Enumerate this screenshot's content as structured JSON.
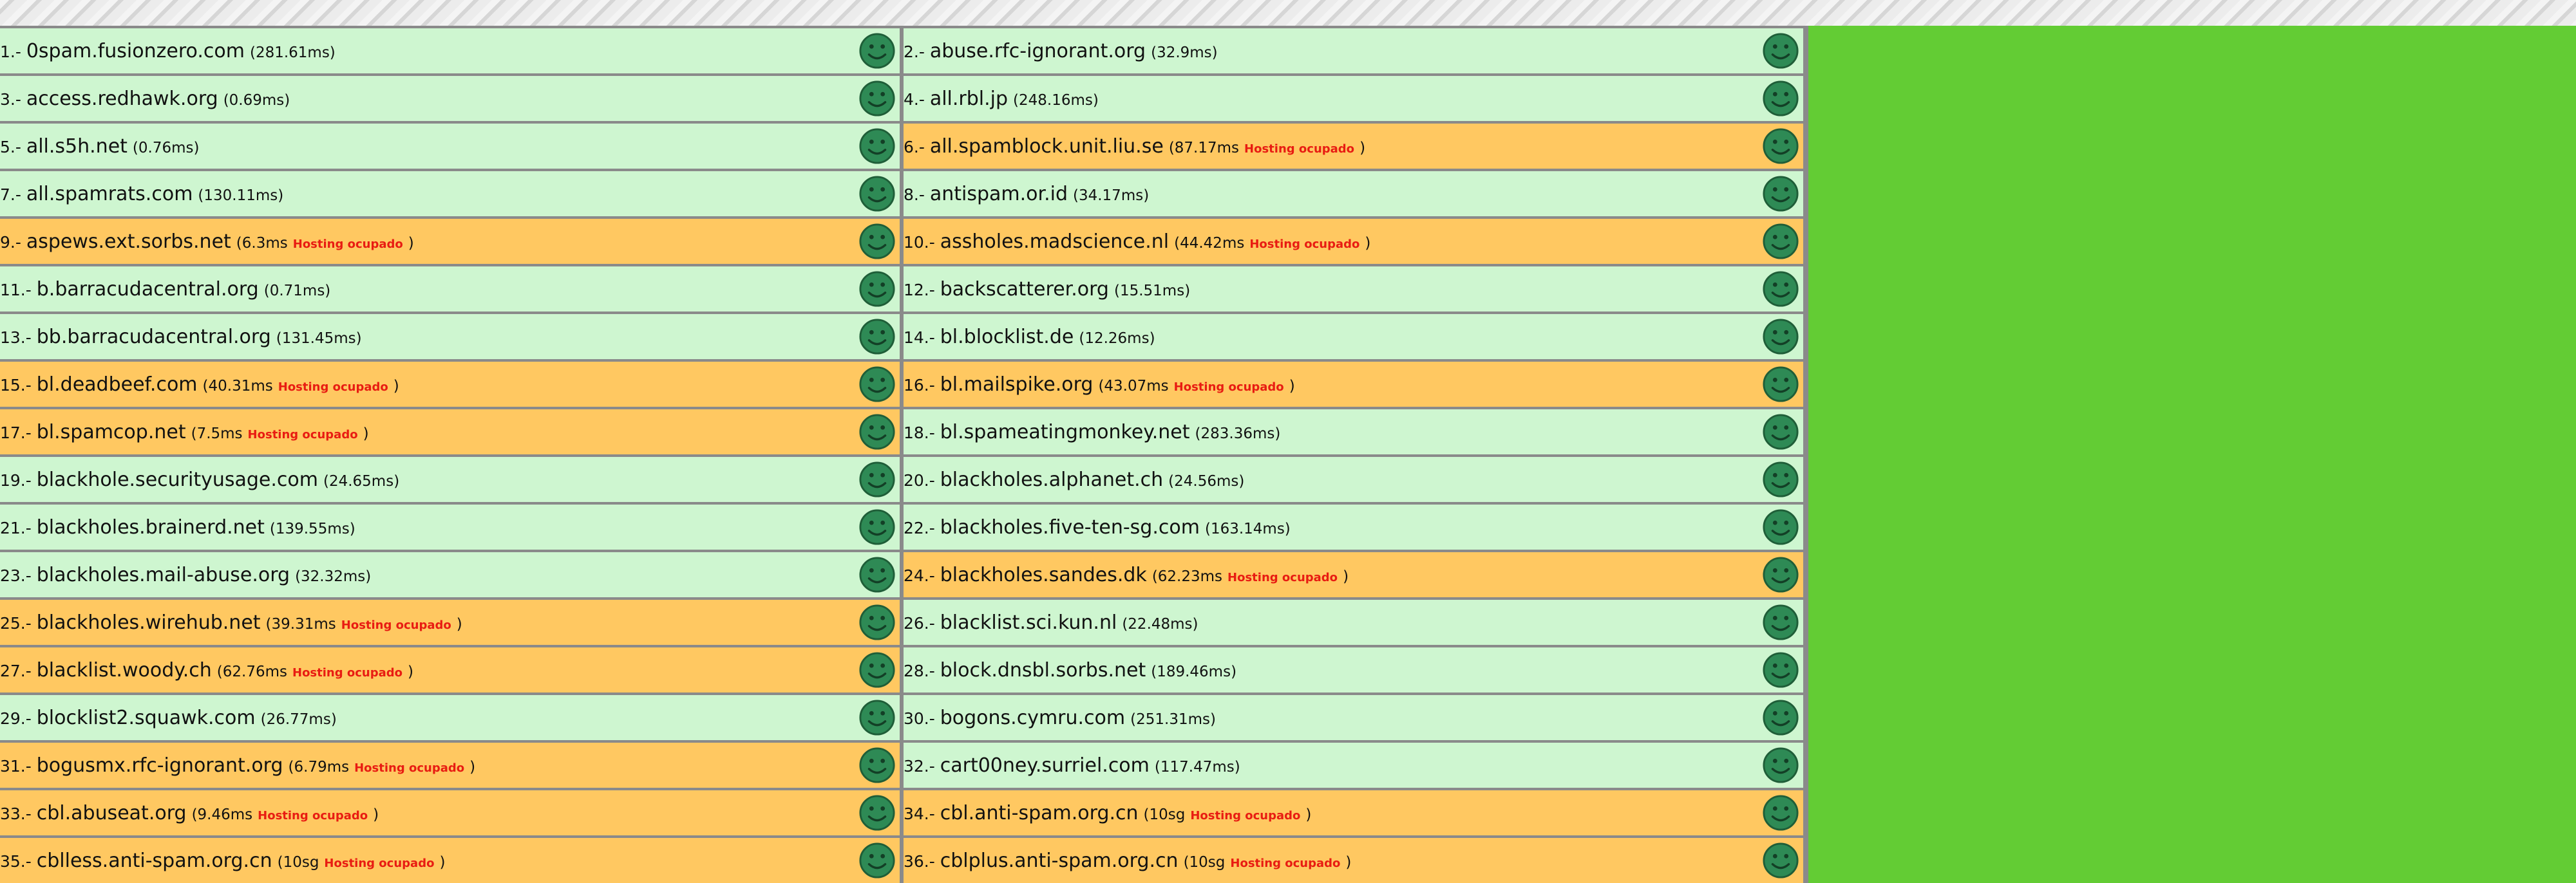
{
  "busy_label": "Hosting ocupado",
  "colors": {
    "ok": "#cef6d0",
    "busy": "#ffc861",
    "page_bg": "#63cc34",
    "busy_text": "#e81c12"
  },
  "icon": "smiley-face-icon",
  "rows": [
    {
      "n": "1.-",
      "host": "0spam.fusionzero.com",
      "time": "281.61ms",
      "busy": false
    },
    {
      "n": "2.-",
      "host": "abuse.rfc-ignorant.org",
      "time": "32.9ms",
      "busy": false
    },
    {
      "n": "3.-",
      "host": "access.redhawk.org",
      "time": "0.69ms",
      "busy": false
    },
    {
      "n": "4.-",
      "host": "all.rbl.jp",
      "time": "248.16ms",
      "busy": false
    },
    {
      "n": "5.-",
      "host": "all.s5h.net",
      "time": "0.76ms",
      "busy": false
    },
    {
      "n": "6.-",
      "host": "all.spamblock.unit.liu.se",
      "time": "87.17ms",
      "busy": true
    },
    {
      "n": "7.-",
      "host": "all.spamrats.com",
      "time": "130.11ms",
      "busy": false
    },
    {
      "n": "8.-",
      "host": "antispam.or.id",
      "time": "34.17ms",
      "busy": false
    },
    {
      "n": "9.-",
      "host": "aspews.ext.sorbs.net",
      "time": "6.3ms",
      "busy": true
    },
    {
      "n": "10.-",
      "host": "assholes.madscience.nl",
      "time": "44.42ms",
      "busy": true
    },
    {
      "n": "11.-",
      "host": "b.barracudacentral.org",
      "time": "0.71ms",
      "busy": false
    },
    {
      "n": "12.-",
      "host": "backscatterer.org",
      "time": "15.51ms",
      "busy": false
    },
    {
      "n": "13.-",
      "host": "bb.barracudacentral.org",
      "time": "131.45ms",
      "busy": false
    },
    {
      "n": "14.-",
      "host": "bl.blocklist.de",
      "time": "12.26ms",
      "busy": false
    },
    {
      "n": "15.-",
      "host": "bl.deadbeef.com",
      "time": "40.31ms",
      "busy": true
    },
    {
      "n": "16.-",
      "host": "bl.mailspike.org",
      "time": "43.07ms",
      "busy": true
    },
    {
      "n": "17.-",
      "host": "bl.spamcop.net",
      "time": "7.5ms",
      "busy": true
    },
    {
      "n": "18.-",
      "host": "bl.spameatingmonkey.net",
      "time": "283.36ms",
      "busy": false
    },
    {
      "n": "19.-",
      "host": "blackhole.securityusage.com",
      "time": "24.65ms",
      "busy": false
    },
    {
      "n": "20.-",
      "host": "blackholes.alphanet.ch",
      "time": "24.56ms",
      "busy": false
    },
    {
      "n": "21.-",
      "host": "blackholes.brainerd.net",
      "time": "139.55ms",
      "busy": false
    },
    {
      "n": "22.-",
      "host": "blackholes.five-ten-sg.com",
      "time": "163.14ms",
      "busy": false
    },
    {
      "n": "23.-",
      "host": "blackholes.mail-abuse.org",
      "time": "32.32ms",
      "busy": false
    },
    {
      "n": "24.-",
      "host": "blackholes.sandes.dk",
      "time": "62.23ms",
      "busy": true
    },
    {
      "n": "25.-",
      "host": "blackholes.wirehub.net",
      "time": "39.31ms",
      "busy": true
    },
    {
      "n": "26.-",
      "host": "blacklist.sci.kun.nl",
      "time": "22.48ms",
      "busy": false
    },
    {
      "n": "27.-",
      "host": "blacklist.woody.ch",
      "time": "62.76ms",
      "busy": true
    },
    {
      "n": "28.-",
      "host": "block.dnsbl.sorbs.net",
      "time": "189.46ms",
      "busy": false
    },
    {
      "n": "29.-",
      "host": "blocklist2.squawk.com",
      "time": "26.77ms",
      "busy": false
    },
    {
      "n": "30.-",
      "host": "bogons.cymru.com",
      "time": "251.31ms",
      "busy": false
    },
    {
      "n": "31.-",
      "host": "bogusmx.rfc-ignorant.org",
      "time": "6.79ms",
      "busy": true
    },
    {
      "n": "32.-",
      "host": "cart00ney.surriel.com",
      "time": "117.47ms",
      "busy": false
    },
    {
      "n": "33.-",
      "host": "cbl.abuseat.org",
      "time": "9.46ms",
      "busy": true
    },
    {
      "n": "34.-",
      "host": "cbl.anti-spam.org.cn",
      "time": "10sg",
      "busy": true
    },
    {
      "n": "35.-",
      "host": "cblless.anti-spam.org.cn",
      "time": "10sg",
      "busy": true
    },
    {
      "n": "36.-",
      "host": "cblplus.anti-spam.org.cn",
      "time": "10sg",
      "busy": true
    }
  ]
}
